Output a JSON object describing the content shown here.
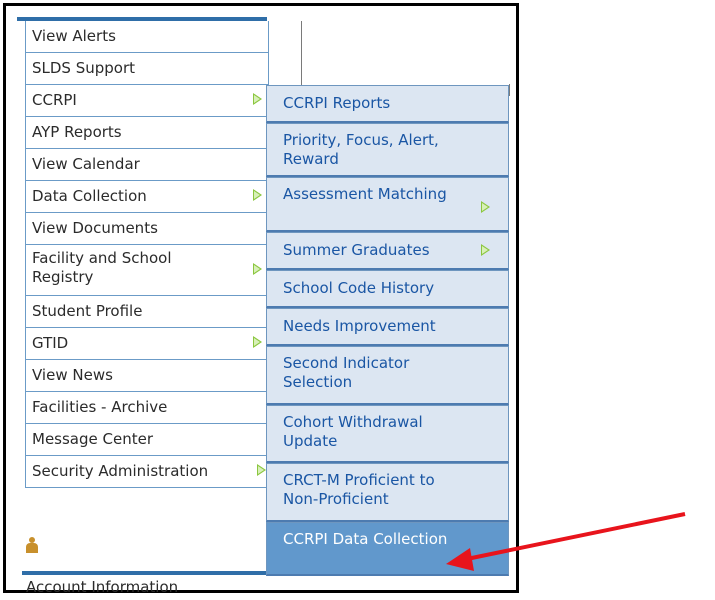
{
  "left_menu": {
    "items": [
      {
        "label": "View Alerts",
        "has_submenu": false
      },
      {
        "label": "SLDS Support",
        "has_submenu": false
      },
      {
        "label": "CCRPI",
        "has_submenu": true
      },
      {
        "label": "AYP Reports",
        "has_submenu": false
      },
      {
        "label": "View Calendar",
        "has_submenu": false
      },
      {
        "label": "Data Collection",
        "has_submenu": true
      },
      {
        "label": "View Documents",
        "has_submenu": false
      },
      {
        "label": "Facility and School Registry",
        "has_submenu": true
      },
      {
        "label": "Student Profile",
        "has_submenu": false
      },
      {
        "label": "GTID",
        "has_submenu": true
      },
      {
        "label": "View News",
        "has_submenu": false
      },
      {
        "label": "Facilities - Archive",
        "has_submenu": false
      },
      {
        "label": "Message Center",
        "has_submenu": false
      },
      {
        "label": "Security Administration",
        "has_submenu": true
      }
    ]
  },
  "submenu": {
    "items": [
      {
        "label": "CCRPI Reports",
        "has_submenu": false,
        "active": false
      },
      {
        "label": "Priority, Focus, Alert, Reward",
        "has_submenu": false,
        "active": false
      },
      {
        "label": "Assessment Matching",
        "has_submenu": true,
        "active": false
      },
      {
        "label": "Summer Graduates",
        "has_submenu": true,
        "active": false
      },
      {
        "label": "School Code History",
        "has_submenu": false,
        "active": false
      },
      {
        "label": "Needs Improvement",
        "has_submenu": false,
        "active": false
      },
      {
        "label": "Second Indicator Selection",
        "has_submenu": false,
        "active": false
      },
      {
        "label": "Cohort Withdrawal Update",
        "has_submenu": false,
        "active": false
      },
      {
        "label": "CRCT-M Proficient to Non-Proficient",
        "has_submenu": false,
        "active": false
      },
      {
        "label": "CCRPI Data Collection",
        "has_submenu": false,
        "active": true
      }
    ]
  },
  "account": {
    "icon": "user-icon",
    "label": "Account Information"
  },
  "colors": {
    "submenu_bg": "#dce6f2",
    "submenu_text": "#1a56a4",
    "active_bg": "#6198cc",
    "accent_bar": "#2f6ea8",
    "annotation_arrow": "#e8141c",
    "submenu_arrow": "#8bc63f"
  }
}
